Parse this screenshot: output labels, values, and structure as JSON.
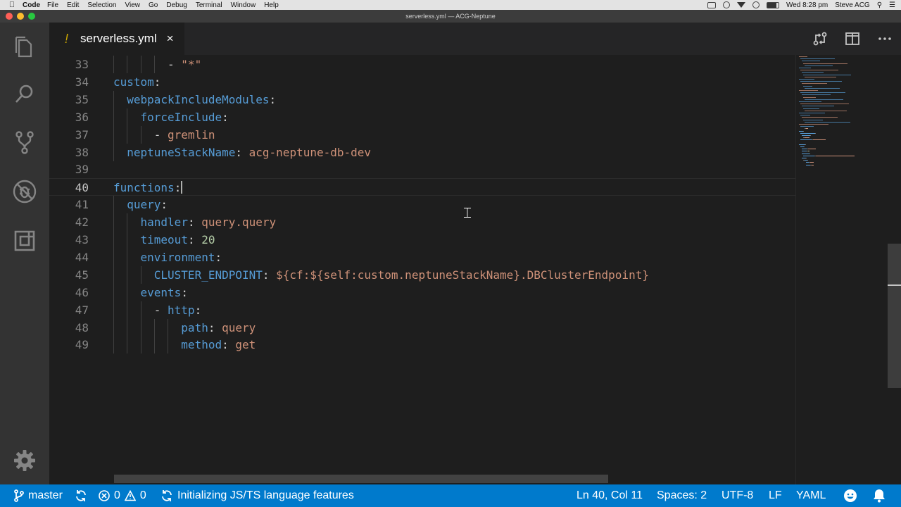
{
  "menubar": {
    "app": "Code",
    "items": [
      "File",
      "Edit",
      "Selection",
      "View",
      "Go",
      "Debug",
      "Terminal",
      "Window",
      "Help"
    ],
    "clock": "Wed 8:28 pm",
    "user": "Steve ACG"
  },
  "window": {
    "title": "serverless.yml — ACG-Neptune"
  },
  "activity_bar": [
    "files-icon",
    "search-icon",
    "source-control-icon",
    "debug-icon",
    "extensions-icon",
    "gear-icon"
  ],
  "tab": {
    "modified_marker": "!",
    "name": "serverless.yml",
    "close": "×"
  },
  "editor": {
    "lines": [
      {
        "n": "33",
        "indent": 4,
        "tokens": [
          [
            "p",
            "- "
          ],
          [
            "s",
            "\"*\""
          ]
        ]
      },
      {
        "n": "34",
        "indent": 0,
        "tokens": [
          [
            "k",
            "custom"
          ],
          [
            "p",
            ":"
          ]
        ]
      },
      {
        "n": "35",
        "indent": 1,
        "tokens": [
          [
            "k",
            "webpackIncludeModules"
          ],
          [
            "p",
            ":"
          ]
        ]
      },
      {
        "n": "36",
        "indent": 2,
        "tokens": [
          [
            "k",
            "forceInclude"
          ],
          [
            "p",
            ":"
          ]
        ]
      },
      {
        "n": "37",
        "indent": 3,
        "tokens": [
          [
            "p",
            "- "
          ],
          [
            "s",
            "gremlin"
          ]
        ]
      },
      {
        "n": "38",
        "indent": 1,
        "tokens": [
          [
            "k",
            "neptuneStackName"
          ],
          [
            "p",
            ": "
          ],
          [
            "s",
            "acg-neptune-db-dev"
          ]
        ]
      },
      {
        "n": "39",
        "indent": 0,
        "tokens": []
      },
      {
        "n": "40",
        "indent": 0,
        "current": true,
        "tokens": [
          [
            "k",
            "functions"
          ],
          [
            "p",
            ":"
          ]
        ]
      },
      {
        "n": "41",
        "indent": 1,
        "tokens": [
          [
            "k",
            "query"
          ],
          [
            "p",
            ":"
          ]
        ]
      },
      {
        "n": "42",
        "indent": 2,
        "tokens": [
          [
            "k",
            "handler"
          ],
          [
            "p",
            ": "
          ],
          [
            "s",
            "query.query"
          ]
        ]
      },
      {
        "n": "43",
        "indent": 2,
        "tokens": [
          [
            "k",
            "timeout"
          ],
          [
            "p",
            ": "
          ],
          [
            "n",
            "20"
          ]
        ]
      },
      {
        "n": "44",
        "indent": 2,
        "tokens": [
          [
            "k",
            "environment"
          ],
          [
            "p",
            ":"
          ]
        ]
      },
      {
        "n": "45",
        "indent": 3,
        "tokens": [
          [
            "k",
            "CLUSTER_ENDPOINT"
          ],
          [
            "p",
            ": "
          ],
          [
            "s",
            "${cf:${self:custom.neptuneStackName}.DBClusterEndpoint}"
          ]
        ]
      },
      {
        "n": "46",
        "indent": 2,
        "tokens": [
          [
            "k",
            "events"
          ],
          [
            "p",
            ":"
          ]
        ]
      },
      {
        "n": "47",
        "indent": 3,
        "tokens": [
          [
            "p",
            "- "
          ],
          [
            "k",
            "http"
          ],
          [
            "p",
            ":"
          ]
        ]
      },
      {
        "n": "48",
        "indent": 5,
        "tokens": [
          [
            "k",
            "path"
          ],
          [
            "p",
            ": "
          ],
          [
            "s",
            "query"
          ]
        ]
      },
      {
        "n": "49",
        "indent": 5,
        "tokens": [
          [
            "k",
            "method"
          ],
          [
            "p",
            ": "
          ],
          [
            "s",
            "get"
          ]
        ]
      }
    ]
  },
  "statusbar": {
    "branch": "master",
    "errors": "0",
    "warnings": "0",
    "task": "Initializing JS/TS language features",
    "position": "Ln 40, Col 11",
    "spaces": "Spaces: 2",
    "encoding": "UTF-8",
    "eol": "LF",
    "language": "YAML"
  },
  "colors": {
    "statusbar": "#007acc",
    "key": "#569cd6",
    "string": "#ce9178",
    "number": "#b5cea8",
    "warning": "#cca700"
  }
}
